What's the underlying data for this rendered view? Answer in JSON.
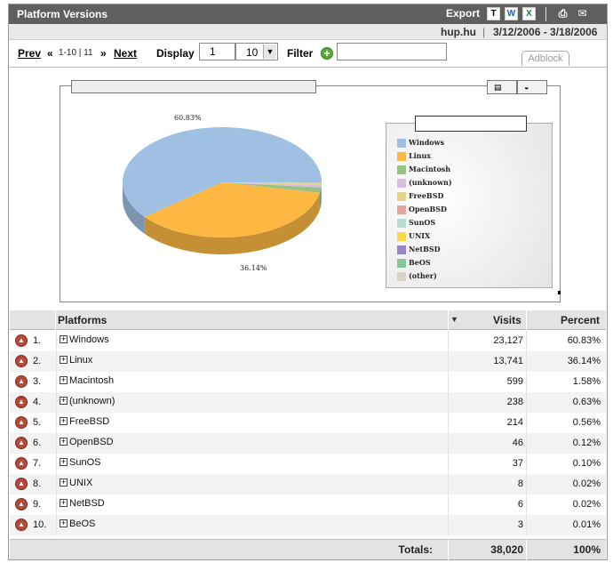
{
  "header": {
    "title": "Platform Versions",
    "export_label": "Export"
  },
  "info": {
    "site": "hup.hu",
    "separator": "|",
    "date_range": "3/12/2006 - 3/18/2006"
  },
  "nav": {
    "prev_label": "Prev",
    "prev_arrows": "«",
    "pages": "1-10 | 11",
    "next_arrows": "»",
    "next_label": "Next",
    "display_label": "Display",
    "display_start": "1",
    "display_count": "10",
    "filter_label": "Filter",
    "filter_value": "",
    "adblock_tab": "Adblock"
  },
  "chart_data": {
    "type": "pie",
    "labels": [
      "Windows",
      "Linux",
      "Macintosh",
      "(unknown)",
      "FreeBSD",
      "OpenBSD",
      "SunOS",
      "UNIX",
      "NetBSD",
      "BeOS",
      "(other)"
    ],
    "values": [
      60.83,
      36.14,
      1.58,
      0.63,
      0.56,
      0.12,
      0.1,
      0.02,
      0.02,
      0.01,
      0.01
    ],
    "data_labels": [
      "60.83%",
      "36.14%"
    ],
    "colors": [
      "#9fc0e2",
      "#fdb843",
      "#98c382",
      "#d9bde0",
      "#e2d486",
      "#e6a4a0",
      "#b9dcd2",
      "#fcd646",
      "#9985c7",
      "#85c69a",
      "#d9d4c7"
    ],
    "legend_position": "right"
  },
  "grid": {
    "headers": {
      "platforms": "Platforms",
      "visits": "Visits",
      "percent": "Percent"
    },
    "rows": [
      {
        "num": "1.",
        "name": "Windows",
        "visits": "23,127",
        "percent": "60.83%"
      },
      {
        "num": "2.",
        "name": "Linux",
        "visits": "13,741",
        "percent": "36.14%"
      },
      {
        "num": "3.",
        "name": "Macintosh",
        "visits": "599",
        "percent": "1.58%"
      },
      {
        "num": "4.",
        "name": "(unknown)",
        "visits": "238",
        "percent": "0.63%"
      },
      {
        "num": "5.",
        "name": "FreeBSD",
        "visits": "214",
        "percent": "0.56%"
      },
      {
        "num": "6.",
        "name": "OpenBSD",
        "visits": "46",
        "percent": "0.12%"
      },
      {
        "num": "7.",
        "name": "SunOS",
        "visits": "37",
        "percent": "0.10%"
      },
      {
        "num": "8.",
        "name": "UNIX",
        "visits": "8",
        "percent": "0.02%"
      },
      {
        "num": "9.",
        "name": "NetBSD",
        "visits": "6",
        "percent": "0.02%"
      },
      {
        "num": "10.",
        "name": "BeOS",
        "visits": "3",
        "percent": "0.01%"
      }
    ],
    "totals": {
      "label": "Totals:",
      "visits": "38,020",
      "percent": "100%"
    }
  }
}
